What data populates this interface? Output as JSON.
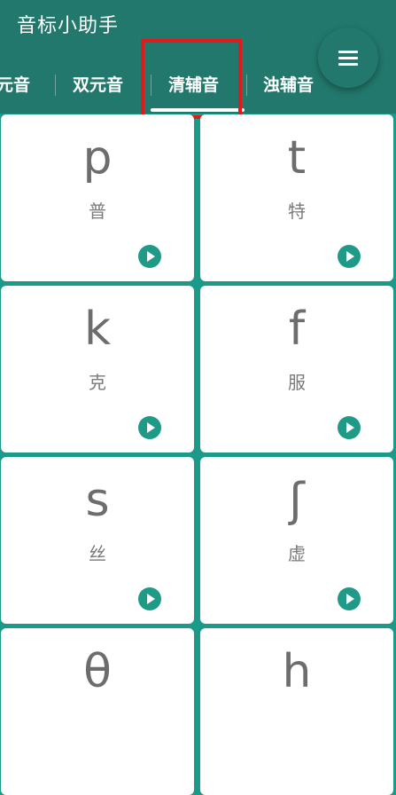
{
  "app": {
    "title": "音标小助手"
  },
  "tabs": [
    {
      "label": "元音"
    },
    {
      "label": "双元音"
    },
    {
      "label": "清辅音",
      "selected": true
    },
    {
      "label": "浊辅音"
    }
  ],
  "menu": {
    "icon": "menu-icon"
  },
  "cards": [
    {
      "symbol": "p",
      "hint": "普"
    },
    {
      "symbol": "t",
      "hint": "特"
    },
    {
      "symbol": "k",
      "hint": "克"
    },
    {
      "symbol": "f",
      "hint": "服"
    },
    {
      "symbol": "s",
      "hint": "丝"
    },
    {
      "symbol": "ʃ",
      "hint": "虚"
    },
    {
      "symbol": "θ",
      "hint": ""
    },
    {
      "symbol": "h",
      "hint": ""
    }
  ],
  "play_icon": "play-icon",
  "colors": {
    "appbar": "#22786c",
    "grid_background": "#1b9a8a",
    "accent": "#1f9a86",
    "highlight": "#e01b1b"
  }
}
